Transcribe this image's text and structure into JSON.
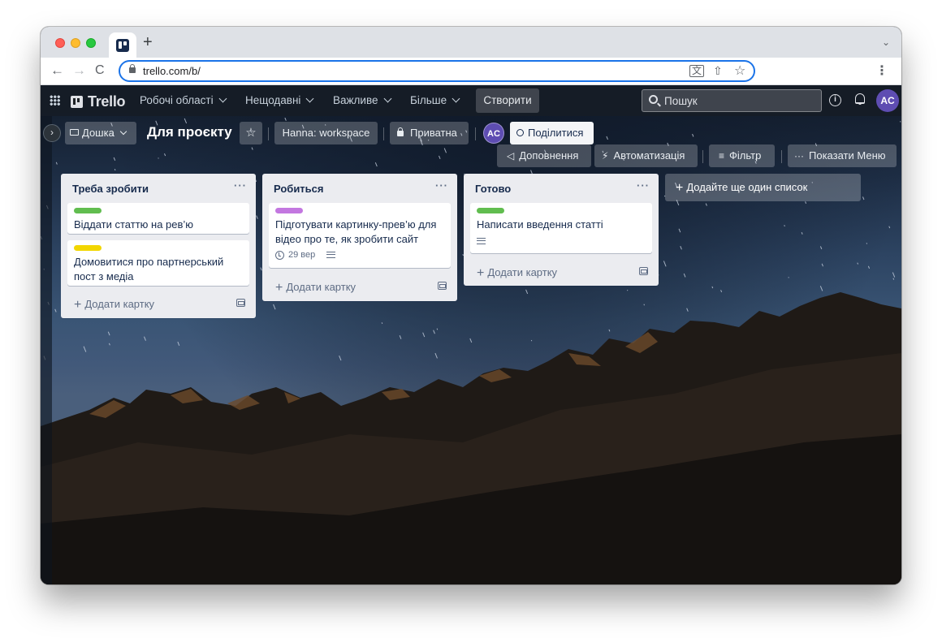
{
  "browser": {
    "url": "trello.com/b/",
    "new_tab_glyph": "+",
    "tabs_menu_glyph": "⌄",
    "back_glyph": "←",
    "forward_glyph": "→",
    "reload_glyph": "C",
    "menu_glyph": "⋮",
    "translate_glyph": "文",
    "share_glyph": "⇧",
    "star_glyph": "☆",
    "icons": [
      "trello-favicon",
      "lock-icon",
      "translate-icon",
      "share-icon",
      "bookmark-star-icon",
      "kebab-icon"
    ]
  },
  "header": {
    "logo": "Trello",
    "menus": [
      {
        "label": "Робочі області"
      },
      {
        "label": "Нещодавні"
      },
      {
        "label": "Важливе"
      },
      {
        "label": "Більше"
      }
    ],
    "create_label": "Створити",
    "search_placeholder": "Пошук",
    "info_glyph": "i",
    "user_initials": "AC",
    "avatar_color": "#5e4db2"
  },
  "board": {
    "sidebar_toggle_glyph": "›",
    "view_label": "Дошка",
    "title": "Для проєкту",
    "star_glyph": "☆",
    "workspace_label": "Hanna: workspace",
    "visibility_label": "Приватна",
    "member_initials": "AC",
    "share_label": "Поділитися",
    "powerups_label": "Доповнення",
    "powerups_glyph": "◁",
    "automation_label": "Автоматизація",
    "automation_glyph": "⚡",
    "filter_label": "Фільтр",
    "filter_glyph": "≡",
    "menu_label": "Показати Меню",
    "menu_glyph": "···",
    "list_menu_glyph": "···",
    "add_card_label": "Додати картку",
    "add_list_label": "Додайте ще один список",
    "plus_glyph": "+",
    "lists": [
      {
        "title": "Треба зробити",
        "cards": [
          {
            "label_color": "#61bd4f",
            "title": "Віддати статтю на рев’ю"
          },
          {
            "label_color": "#f2d600",
            "title": "Домовитися про партнерський пост з медіа"
          }
        ]
      },
      {
        "title": "Робиться",
        "cards": [
          {
            "label_color": "#c377e0",
            "title": "Підготувати картинку-прев’ю для відео про те, як зробити сайт",
            "due": "29 вер",
            "has_description": true
          }
        ]
      },
      {
        "title": "Готово",
        "cards": [
          {
            "label_color": "#61bd4f",
            "title": "Написати введення статті",
            "has_description": true
          }
        ]
      }
    ]
  }
}
